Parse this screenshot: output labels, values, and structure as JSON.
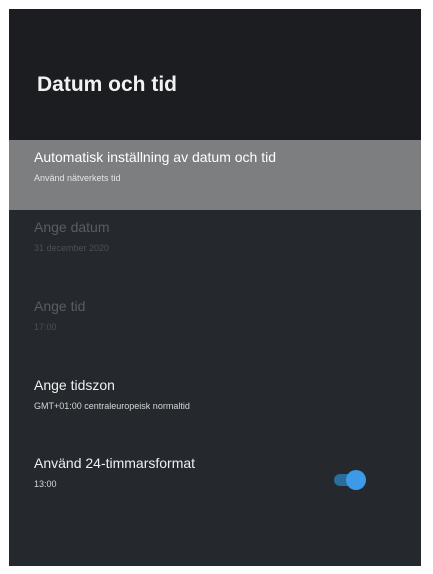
{
  "page": {
    "title": "Datum och tid"
  },
  "settings": [
    {
      "label": "Automatisk inställning av datum och tid",
      "value": "Använd nätverkets tid",
      "state": "focused"
    },
    {
      "label": "Ange datum",
      "value": "31 december 2020",
      "state": "disabled"
    },
    {
      "label": "Ange tid",
      "value": "17:00",
      "state": "disabled"
    },
    {
      "label": "Ange tidszon",
      "value": "GMT+01:00 centraleuropeisk normaltid",
      "state": "enabled"
    },
    {
      "label": "Använd 24-timmarsformat",
      "value": "13:00",
      "state": "enabled",
      "toggle_on": true
    }
  ],
  "colors": {
    "accent": "#3c9ae8",
    "panel_bg": "#25282c",
    "header_bg": "#1c1d20",
    "focus_bg": "#7d7e80"
  }
}
